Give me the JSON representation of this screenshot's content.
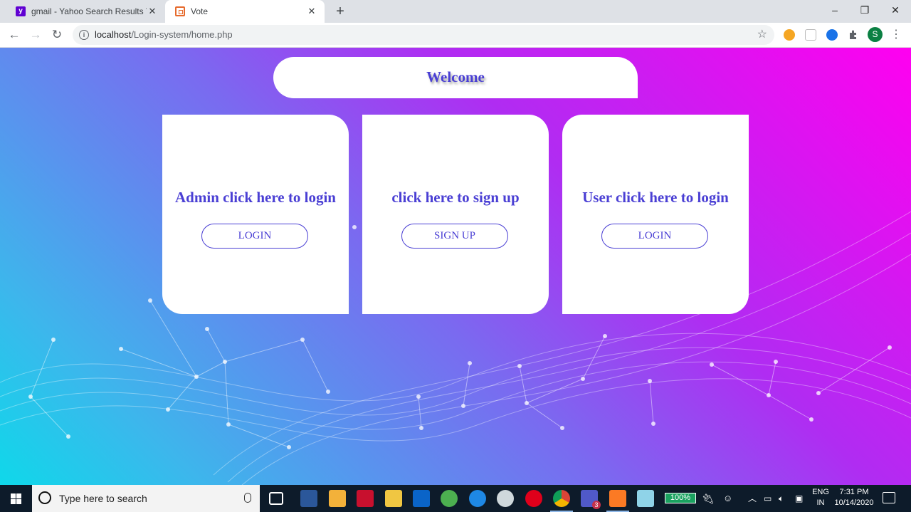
{
  "browser": {
    "tabs": [
      {
        "title": "gmail - Yahoo Search Results Yah",
        "favicon": "yahoo-favicon",
        "active": false
      },
      {
        "title": "Vote",
        "favicon": "xampp-favicon",
        "active": true
      }
    ],
    "new_tab_symbol": "+",
    "window_controls": {
      "minimize": "–",
      "restore": "❐",
      "close": "✕"
    },
    "nav": {
      "back": "←",
      "forward": "→",
      "reload": "↻"
    },
    "address": {
      "host": "localhost",
      "path": "/Login-system/home.php",
      "info_icon": "i"
    },
    "bookmark_star": "☆",
    "profile_initial": "S",
    "menu_symbol": "⋮"
  },
  "page": {
    "welcome": "Welcome",
    "cards": [
      {
        "heading": "Admin click here to login",
        "button": "LOGIN"
      },
      {
        "heading": "click here to sign up",
        "button": "SIGN UP"
      },
      {
        "heading": "User click here to login",
        "button": "LOGIN"
      }
    ],
    "colors": {
      "accent": "#4a3fd4",
      "gradient_start": "#ff00f0",
      "gradient_end": "#0fd8ea"
    }
  },
  "taskbar": {
    "search_placeholder": "Type here to search",
    "battery": "100%",
    "language": [
      "ENG",
      "IN"
    ],
    "time": "7:31 PM",
    "date": "10/14/2020",
    "teams_badge": "3"
  }
}
